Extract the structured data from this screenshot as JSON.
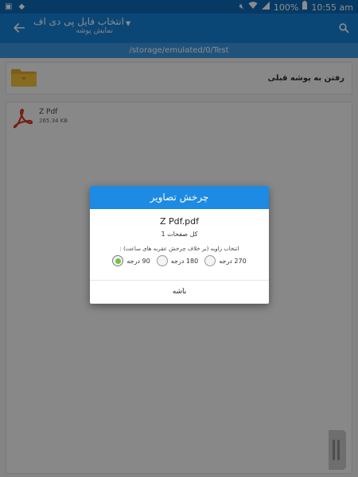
{
  "status_bar": {
    "battery": "100%",
    "time": "10:55 am"
  },
  "app_bar": {
    "title": "انتخاب فایل پی دی اف",
    "subtitle": "نمایش پوشه"
  },
  "path": "/storage/emulated/0/Test",
  "parent_folder": {
    "label": "رفتن به پوشه قبلی"
  },
  "files": [
    {
      "name": "Z Pdf",
      "size": "265.34 KB"
    }
  ],
  "dialog": {
    "title": "چرخش تصاویر",
    "filename": "Z Pdf.pdf",
    "pages": "کل صفحات 1",
    "prompt": "انتخاب زاویه (بر خلاف چرخش عقربه های ساعت) :",
    "options": [
      {
        "label": "90 درجه",
        "selected": true
      },
      {
        "label": "180 درجه",
        "selected": false
      },
      {
        "label": "270 درجه",
        "selected": false
      }
    ],
    "ok_label": "باشه"
  },
  "colors": {
    "status_bar": "#0c6ab8",
    "app_bar": "#1581d7",
    "path_bar": "#3a97e0",
    "dialog_header": "#1d8ae3",
    "radio_selected": "#6cc644",
    "pdf_red": "#d9331e",
    "folder_yellow": "#f3c13a"
  }
}
